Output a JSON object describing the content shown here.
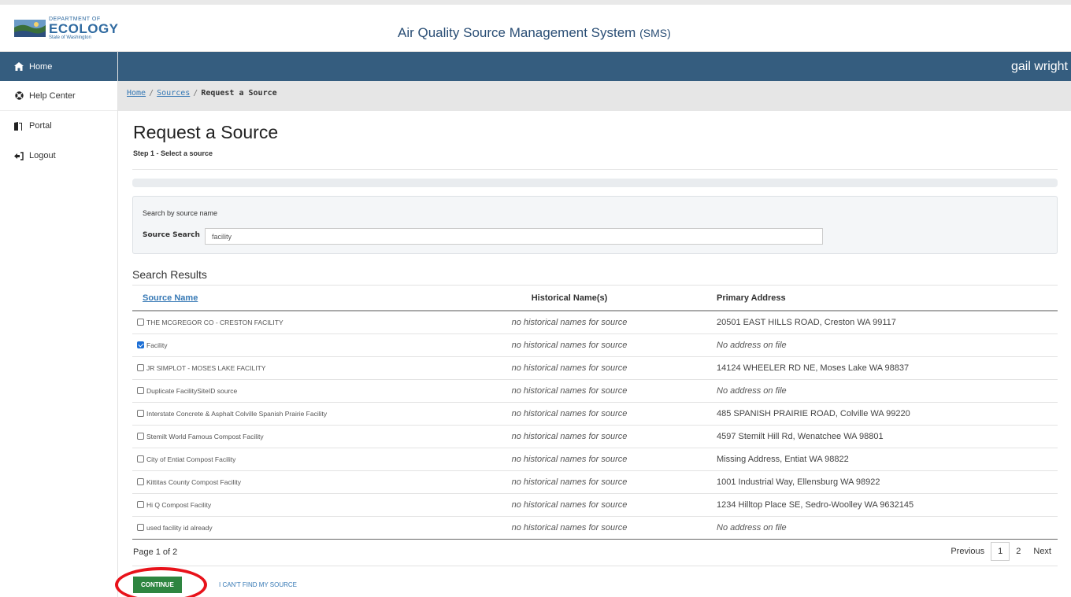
{
  "header": {
    "logo": {
      "dept": "DEPARTMENT OF",
      "name": "ECOLOGY",
      "state": "State of Washington"
    },
    "app_title": "Air Quality Source Management System",
    "app_abbr": "(SMS)"
  },
  "sidebar": {
    "items": [
      {
        "label": "Home",
        "icon": "home-icon"
      },
      {
        "label": "Help Center",
        "icon": "life-ring-icon"
      },
      {
        "label": "Portal",
        "icon": "door-icon"
      },
      {
        "label": "Logout",
        "icon": "sign-out-icon"
      }
    ]
  },
  "user": {
    "name": "gail wright"
  },
  "breadcrumb": {
    "home": "Home",
    "sep": "/",
    "sources": "Sources",
    "current": "Request a Source"
  },
  "page": {
    "title": "Request a Source",
    "step": "Step 1 - Select a source"
  },
  "search": {
    "hint": "Search by source name",
    "label": "Source Search",
    "value": "facility"
  },
  "results": {
    "title": "Search Results",
    "columns": [
      "Source Name",
      "Historical Name(s)",
      "Primary Address"
    ],
    "rows": [
      {
        "name": "THE MCGREGOR CO - CRESTON FACILITY",
        "checked": false,
        "historical": "no historical names for source",
        "address": "20501 EAST HILLS ROAD, Creston WA 99117"
      },
      {
        "name": "Facility",
        "checked": true,
        "historical": "no historical names for source",
        "address": "No address on file"
      },
      {
        "name": "JR SIMPLOT - MOSES LAKE FACILITY",
        "checked": false,
        "historical": "no historical names for source",
        "address": "14124 WHEELER RD NE, Moses Lake WA 98837"
      },
      {
        "name": "Duplicate FacilitySiteID source",
        "checked": false,
        "historical": "no historical names for source",
        "address": "No address on file"
      },
      {
        "name": "Interstate Concrete & Asphalt Colville Spanish Prairie Facility",
        "checked": false,
        "historical": "no historical names for source",
        "address": "485 SPANISH PRAIRIE ROAD, Colville WA 99220"
      },
      {
        "name": "Stemilt World Famous Compost Facility",
        "checked": false,
        "historical": "no historical names for source",
        "address": "4597 Stemilt Hill Rd, Wenatchee WA 98801"
      },
      {
        "name": "City of Entiat Compost Facility",
        "checked": false,
        "historical": "no historical names for source",
        "address": "Missing Address, Entiat WA 98822"
      },
      {
        "name": "Kittitas County Compost Facility",
        "checked": false,
        "historical": "no historical names for source",
        "address": "1001 Industrial Way, Ellensburg WA 98922"
      },
      {
        "name": "Hi Q Compost Facility",
        "checked": false,
        "historical": "no historical names for source",
        "address": "1234 Hilltop Place SE, Sedro-Woolley WA 9632145"
      },
      {
        "name": "used facility id already",
        "checked": false,
        "historical": "no historical names for source",
        "address": "No address on file"
      }
    ]
  },
  "pagination": {
    "info": "Page 1 of 2",
    "previous": "Previous",
    "pages": [
      "1",
      "2"
    ],
    "current": "1",
    "next": "Next"
  },
  "actions": {
    "continue": "CONTINUE",
    "cant_find": "I CAN'T FIND MY SOURCE"
  },
  "colors": {
    "nav_blue": "#355d7f",
    "link_blue": "#3779b5",
    "continue_green": "#2e8540",
    "annotation_red": "#e8121a"
  }
}
